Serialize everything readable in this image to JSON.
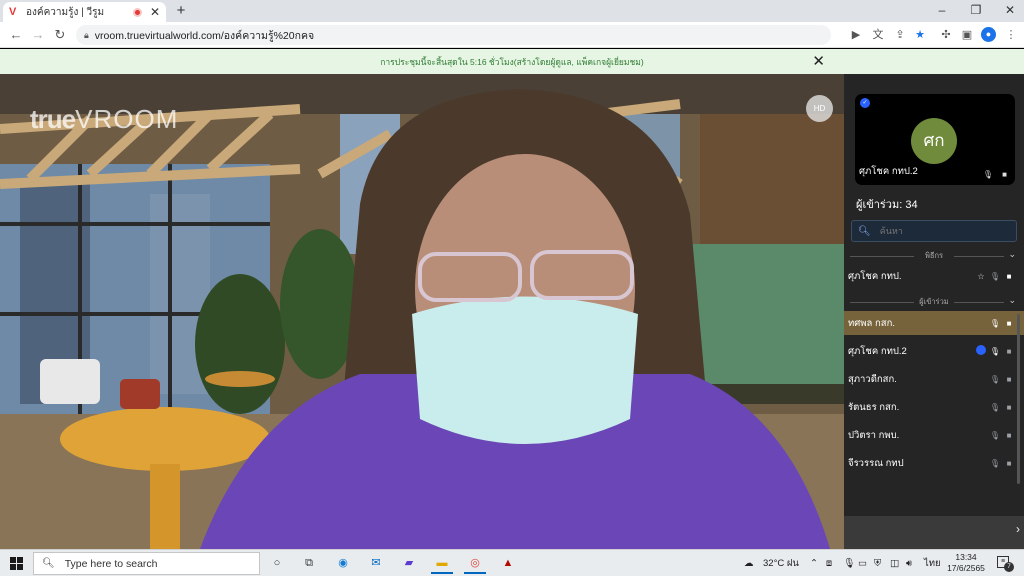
{
  "browser": {
    "tab_title": "องค์ความรู้ง | วีรูม",
    "tab_favicon": "V",
    "url": "vroom.truevirtualworld.com/องค์ความรู้%20กคจ",
    "new_tab": "+",
    "window_controls": [
      "–",
      "❐",
      "✕"
    ]
  },
  "banner": {
    "message": "การประชุมนี้จะสิ้นสุดใน 5:16 ชั่วโมง(สร้างโดยผู้ดูแล, แพ็คเกจผู้เยี่ยมชม)",
    "close": "✕"
  },
  "video": {
    "logo_bold": "true",
    "logo_light": "VROOM",
    "quality_badge": "HD"
  },
  "panel": {
    "self_initials": "ศก",
    "self_name": "ศุภโชค กทป.2",
    "participant_count": "ผู้เข้าร่วม: 34",
    "search_placeholder": "ค้นหา",
    "host_section": "พิธีกร",
    "host": {
      "name": "ศุภโชค กทป."
    },
    "participants_section": "ผู้เข้าร่วม",
    "participants": [
      {
        "name": "ทศพล กสก.",
        "active": true,
        "shield": false,
        "mic_on": true
      },
      {
        "name": "ศุภโชค กทป.2",
        "active": false,
        "shield": true,
        "mic_on": true
      },
      {
        "name": "สุภาวดีกสก.",
        "active": false,
        "shield": false,
        "mic_on": false
      },
      {
        "name": "รัตนธร กสก.",
        "active": false,
        "shield": false,
        "mic_on": false
      },
      {
        "name": "ปวิตรา กพบ.",
        "active": false,
        "shield": false,
        "mic_on": false
      },
      {
        "name": "จีรวรรณ กทป",
        "active": false,
        "shield": false,
        "mic_on": false
      }
    ],
    "expand_arrow": "›"
  },
  "taskbar": {
    "search_placeholder": "Type here to search",
    "weather": "32°C ฝน",
    "language": "ไทย",
    "time": "13:34",
    "date": "17/6/2565",
    "notifications": "7"
  },
  "colors": {
    "banner_bg": "#e7f5e4",
    "banner_text": "#2e7d32",
    "panel_bg": "#252525",
    "active_row": "#76633c",
    "avatar": "#6f8b3b",
    "accent_blue": "#2962ff"
  }
}
